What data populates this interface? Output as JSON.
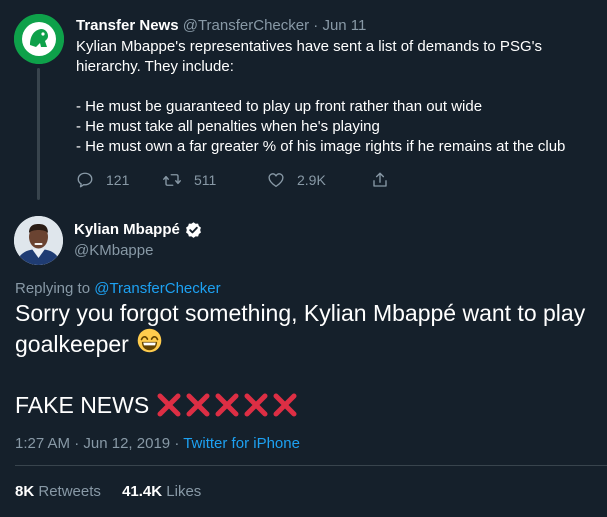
{
  "parent_tweet": {
    "name": "Transfer News",
    "handle": "@TransferChecker",
    "separator": "·",
    "date": "Jun 11",
    "text_intro": [
      "Kylian Mbappe's representatives have sent a list of demands to PSG's",
      "hierarchy. They include:"
    ],
    "demands": [
      "- He must be guaranteed to play up front rather than out wide",
      "- He must take all penalties when he's playing",
      "- He must own a far greater % of his image rights if he remains at the club"
    ],
    "actions": {
      "reply_count": "121",
      "retweet_count": "511",
      "like_count": "2.9K"
    },
    "colors": {
      "avatar_bg": "#0ea14a"
    }
  },
  "main_tweet": {
    "name": "Kylian Mbappé",
    "handle": "@KMbappe",
    "replying_prefix": "Replying to",
    "replying_handle": "@TransferChecker",
    "text_line1": "Sorry you forgot something, Kylian Mbappé want to play",
    "text_line2": "goalkeeper",
    "fake_news": "FAKE NEWS",
    "time": "1:27 AM",
    "separator": "·",
    "date": "Jun 12, 2019",
    "client": "Twitter for iPhone",
    "stats": {
      "retweets_count": "8K",
      "retweets_label": "Retweets",
      "likes_count": "41.4K",
      "likes_label": "Likes"
    }
  },
  "icons": {
    "reply": "reply-icon",
    "retweet": "retweet-icon",
    "like": "heart-icon",
    "share": "share-icon",
    "verified": "verified-badge-icon",
    "grin_emoji": "grinning-face-emoji",
    "x_emoji": "cross-mark-emoji"
  },
  "colors": {
    "background": "#15202b",
    "text": "#ffffff",
    "muted": "#8899a6",
    "link": "#1da1f2",
    "divider": "#38444d",
    "cross_mark": "#dd2e44"
  }
}
